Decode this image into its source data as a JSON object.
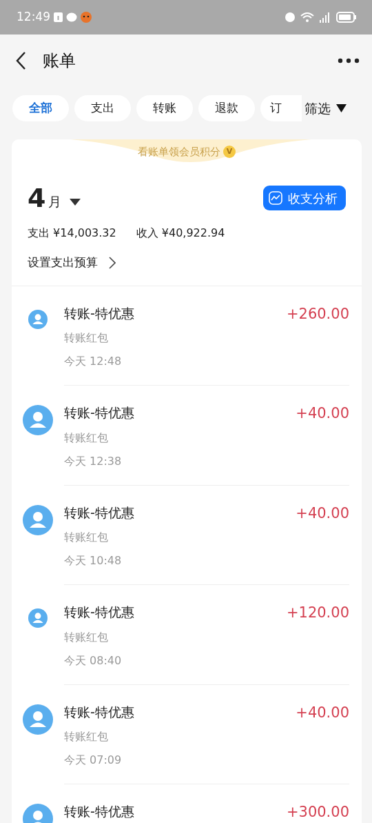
{
  "status_bar": {
    "time": "12:49"
  },
  "header": {
    "title": "账单"
  },
  "filters": [
    {
      "label": "全部",
      "selected": true
    },
    {
      "label": "支出",
      "selected": false
    },
    {
      "label": "转账",
      "selected": false
    },
    {
      "label": "退款",
      "selected": false
    },
    {
      "label": "订",
      "selected": false
    }
  ],
  "filter_button": "筛选",
  "banner": {
    "text": "看账单领会员积分",
    "badge": "V"
  },
  "summary": {
    "month": "4",
    "month_unit": "月",
    "analysis_button": "收支分析",
    "expense": "支出 ¥14,003.32",
    "income": "收入 ¥40,922.94",
    "budget_link": "设置支出预算"
  },
  "transactions": [
    {
      "kind": "small",
      "title": "转账-特优惠",
      "subtitle": "转账红包",
      "time": "今天 12:48",
      "amount": "+260.00"
    },
    {
      "kind": "large",
      "title": "转账-特优惠",
      "subtitle": "转账红包",
      "time": "今天 12:38",
      "amount": "+40.00"
    },
    {
      "kind": "large",
      "title": "转账-特优惠",
      "subtitle": "转账红包",
      "time": "今天 10:48",
      "amount": "+40.00"
    },
    {
      "kind": "small",
      "title": "转账-特优惠",
      "subtitle": "转账红包",
      "time": "今天 08:40",
      "amount": "+120.00"
    },
    {
      "kind": "large",
      "title": "转账-特优惠",
      "subtitle": "转账红包",
      "time": "今天 07:09",
      "amount": "+40.00"
    },
    {
      "kind": "large",
      "title": "转账-特优惠",
      "amount": "+300.00"
    }
  ]
}
